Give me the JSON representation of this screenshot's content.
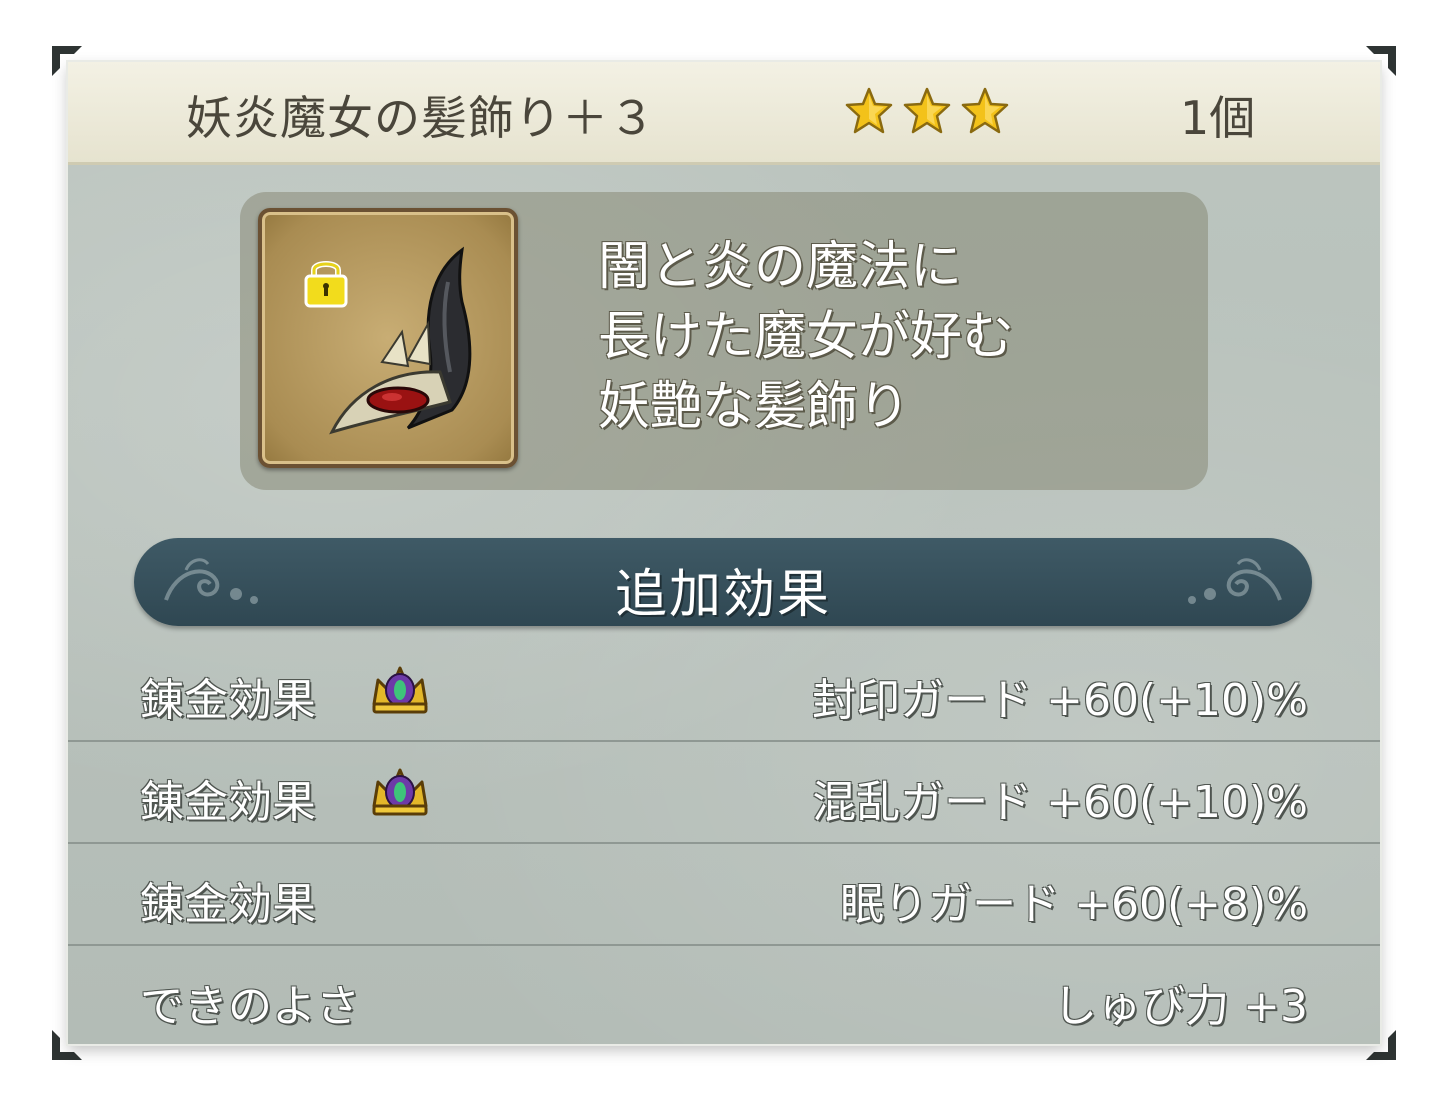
{
  "header": {
    "item_name": "妖炎魔女の髪飾り＋３",
    "star_rating": 3,
    "star_icons": [
      "star-icon",
      "star-icon",
      "star-icon"
    ],
    "count": "1個"
  },
  "item": {
    "icon": "horned-hair-ornament-icon",
    "lock_icon": "lock-icon",
    "description_lines": [
      "闇と炎の魔法に",
      "長けた魔女が好む",
      "妖艶な髪飾り"
    ]
  },
  "section": {
    "title": "追加効果"
  },
  "effects": [
    {
      "label": "錬金効果",
      "icon": "crown-icon",
      "value": "封印ガード +60(+10)%"
    },
    {
      "label": "錬金効果",
      "icon": "crown-icon",
      "value": "混乱ガード +60(+10)%"
    },
    {
      "label": "錬金効果",
      "icon": "",
      "value": "眠りガード +60(+8)%"
    },
    {
      "label": "できのよさ",
      "icon": "",
      "value": "しゅび力 +3"
    }
  ],
  "colors": {
    "header_bg": "#ece9d8",
    "panel_bg": "#b9c2bc",
    "banner_bg": "#3a535e",
    "star": "#f3c21a"
  }
}
